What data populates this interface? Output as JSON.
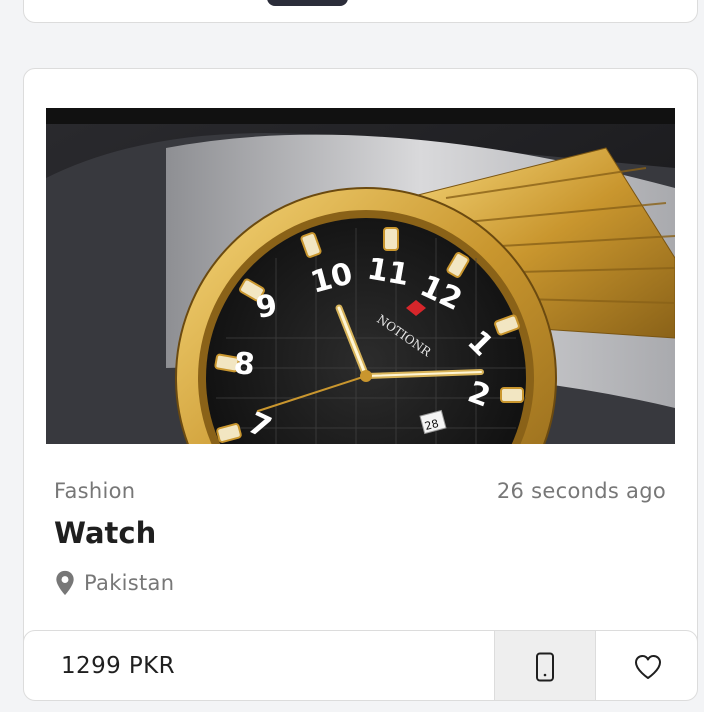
{
  "listing": {
    "category": "Fashion",
    "posted_time": "26 seconds ago",
    "title": "Watch",
    "location": "Pakistan",
    "price": "1299 PKR",
    "image": {
      "subject": "gold-wristwatch",
      "brand_text": "NOTIONR",
      "date_window": "28"
    }
  },
  "icons": {
    "location": "map-pin-icon",
    "call": "phone-icon",
    "favorite": "heart-icon"
  },
  "colors": {
    "text_primary": "#1f1f1f",
    "text_muted": "#777777",
    "card_border": "#dcdcdc",
    "button_bg": "#eeeeee",
    "watch_gold": "#d4a437"
  }
}
